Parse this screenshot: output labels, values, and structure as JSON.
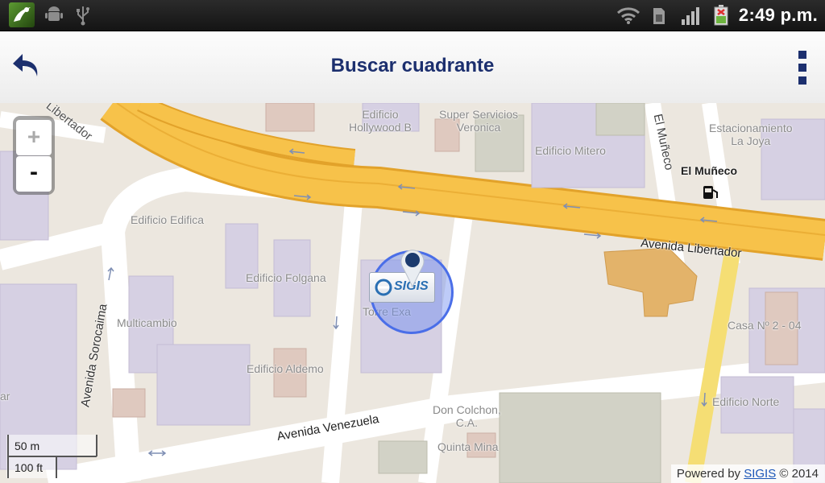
{
  "status_bar": {
    "time": "2:49 p.m."
  },
  "header": {
    "title": "Buscar cuadrante"
  },
  "map": {
    "zoom_in": "+",
    "zoom_out": "-",
    "labels": {
      "libertador_nw": "Libertador",
      "edificio_hollywood": "Edificio\nHollywood B",
      "super_servicios": "Super Servicios\nVeronica",
      "edificio_mitero": "Edificio Mitero",
      "el_muneco_street": "El Muñeco",
      "estacionamiento": "Estacionamiento\nLa Joya",
      "el_muneco_poi": "El Muñeco",
      "avenida_libertador": "Avenida Libertador",
      "edificio_edifica": "Edificio Edifica",
      "edificio_folgana": "Edificio Folgana",
      "torre_exa": "Torre Exa",
      "multicambio": "Multicambio",
      "avenida_sorocaima": "Avenida Sorocaima",
      "edificio_aldemo": "Edificio Aldemo",
      "casa_n2": "Casa Nº 2 - 04",
      "edificio_norte": "Edificio Norte",
      "don_colchon": "Don Colchon,\nC.A.",
      "quinta_mina": "Quinta Mina",
      "avenida_venezuela": "Avenida Venezuela",
      "partial_left": "ar"
    },
    "logo_text": "SIGIS",
    "scale": {
      "metric": "50 m",
      "imperial": "100 ft"
    },
    "attribution": {
      "prefix": "Powered by",
      "link": "SIGIS",
      "suffix": "© 2014"
    }
  },
  "colors": {
    "accent": "#1c2f6e",
    "highway": "#f7c24a",
    "building": "#d6d0e3",
    "land": "#ece7df"
  }
}
